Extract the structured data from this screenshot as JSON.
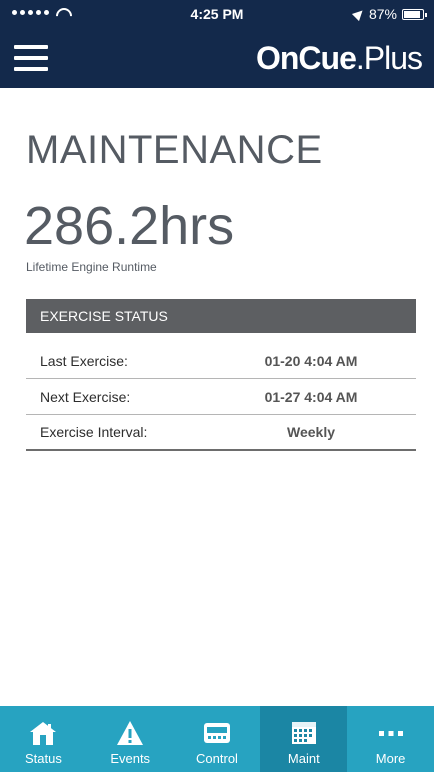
{
  "status_bar": {
    "time": "4:25 PM",
    "battery_percent": "87%",
    "battery_level": 0.87
  },
  "nav": {
    "brand_bold": "OnCue",
    "brand_light": ".Plus"
  },
  "main": {
    "title": "MAINTENANCE",
    "runtime_value": "286.2hrs",
    "runtime_label": "Lifetime Engine Runtime"
  },
  "exercise": {
    "header": "EXERCISE STATUS",
    "rows": [
      {
        "label": "Last Exercise:",
        "value": "01-20 4:04 AM"
      },
      {
        "label": "Next Exercise:",
        "value": "01-27 4:04 AM"
      },
      {
        "label": "Exercise Interval:",
        "value": "Weekly"
      }
    ]
  },
  "tabs": [
    {
      "label": "Status",
      "icon": "home-icon"
    },
    {
      "label": "Events",
      "icon": "warning-icon"
    },
    {
      "label": "Control",
      "icon": "control-panel-icon"
    },
    {
      "label": "Maint",
      "icon": "calendar-icon",
      "active": true
    },
    {
      "label": "More",
      "icon": "more-icon"
    }
  ],
  "colors": {
    "nav": "#13294b",
    "tabbar": "#27a3c1",
    "tab_active": "#1b86a4",
    "section_header": "#5d5f62"
  }
}
